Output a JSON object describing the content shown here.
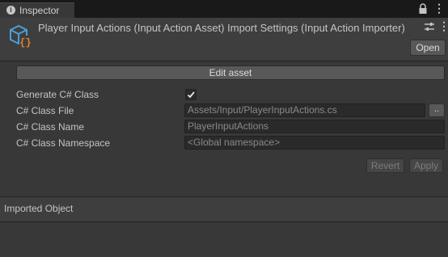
{
  "tab": {
    "label": "Inspector",
    "info_glyph": "i"
  },
  "header": {
    "title": "Player Input Actions (Input Action Asset) Import Settings (Input Action Importer)",
    "open_label": "Open"
  },
  "main": {
    "edit_asset_label": "Edit asset",
    "generate_class": {
      "label": "Generate C# Class",
      "checked": true
    },
    "class_file": {
      "label": "C# Class File",
      "value": "Assets/Input/PlayerInputActions.cs",
      "browse_label": ".."
    },
    "class_name": {
      "label": "C# Class Name",
      "value": "PlayerInputActions"
    },
    "class_namespace": {
      "label": "C# Class Namespace",
      "placeholder": "<Global namespace>"
    },
    "revert_label": "Revert",
    "apply_label": "Apply"
  },
  "imported": {
    "label": "Imported Object"
  },
  "icons": {
    "tab_info": "info-icon",
    "lock": "lock-icon",
    "menu": "kebab-menu-icon",
    "asset": "input-action-asset-icon",
    "settings": "preset-settings-icon",
    "check": "checkmark-icon"
  },
  "colors": {
    "window_bg": "#383838",
    "header_bg": "#3e3e3e",
    "tabbar_bg": "#191919",
    "button_bg": "#585858",
    "field_bg": "#2a2a2a",
    "icon_blue": "#4a9fd8",
    "icon_orange": "#e8832a"
  }
}
